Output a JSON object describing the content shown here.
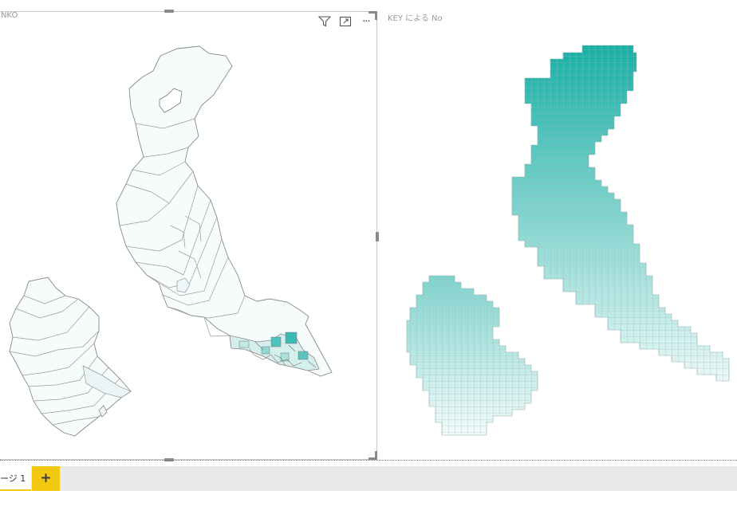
{
  "canvas": {
    "left_visual": {
      "title": "INKO",
      "header_icons": [
        "filter-icon",
        "focus-mode-icon",
        "more-options-icon"
      ],
      "more_label": "···"
    },
    "right_visual": {
      "title": "KEY による No"
    }
  },
  "colors": {
    "teal_dark": "#14b1a7",
    "teal_light": "#e6f7f6",
    "map_fill": "#f4fbfb",
    "outline": "#8a8a8a",
    "accent_yellow": "#f2c811"
  },
  "page_tabs": {
    "active_label": "ージ 1",
    "add_label": "+"
  }
}
